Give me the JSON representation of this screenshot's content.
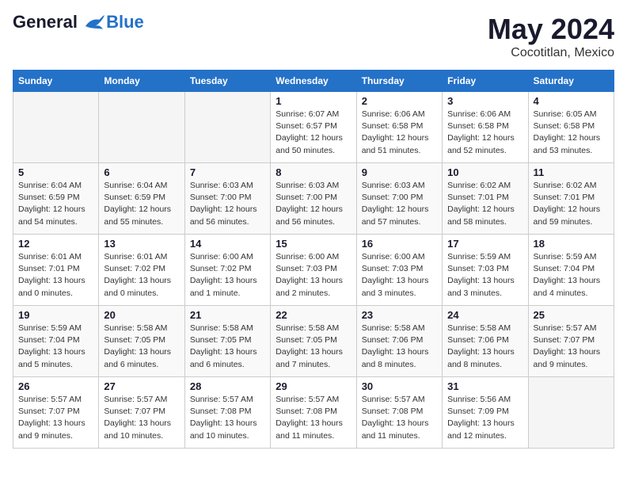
{
  "logo": {
    "line1": "General",
    "line2": "Blue"
  },
  "title": "May 2024",
  "subtitle": "Cocotitlan, Mexico",
  "days_of_week": [
    "Sunday",
    "Monday",
    "Tuesday",
    "Wednesday",
    "Thursday",
    "Friday",
    "Saturday"
  ],
  "weeks": [
    [
      {
        "num": "",
        "detail": ""
      },
      {
        "num": "",
        "detail": ""
      },
      {
        "num": "",
        "detail": ""
      },
      {
        "num": "1",
        "detail": "Sunrise: 6:07 AM\nSunset: 6:57 PM\nDaylight: 12 hours\nand 50 minutes."
      },
      {
        "num": "2",
        "detail": "Sunrise: 6:06 AM\nSunset: 6:58 PM\nDaylight: 12 hours\nand 51 minutes."
      },
      {
        "num": "3",
        "detail": "Sunrise: 6:06 AM\nSunset: 6:58 PM\nDaylight: 12 hours\nand 52 minutes."
      },
      {
        "num": "4",
        "detail": "Sunrise: 6:05 AM\nSunset: 6:58 PM\nDaylight: 12 hours\nand 53 minutes."
      }
    ],
    [
      {
        "num": "5",
        "detail": "Sunrise: 6:04 AM\nSunset: 6:59 PM\nDaylight: 12 hours\nand 54 minutes."
      },
      {
        "num": "6",
        "detail": "Sunrise: 6:04 AM\nSunset: 6:59 PM\nDaylight: 12 hours\nand 55 minutes."
      },
      {
        "num": "7",
        "detail": "Sunrise: 6:03 AM\nSunset: 7:00 PM\nDaylight: 12 hours\nand 56 minutes."
      },
      {
        "num": "8",
        "detail": "Sunrise: 6:03 AM\nSunset: 7:00 PM\nDaylight: 12 hours\nand 56 minutes."
      },
      {
        "num": "9",
        "detail": "Sunrise: 6:03 AM\nSunset: 7:00 PM\nDaylight: 12 hours\nand 57 minutes."
      },
      {
        "num": "10",
        "detail": "Sunrise: 6:02 AM\nSunset: 7:01 PM\nDaylight: 12 hours\nand 58 minutes."
      },
      {
        "num": "11",
        "detail": "Sunrise: 6:02 AM\nSunset: 7:01 PM\nDaylight: 12 hours\nand 59 minutes."
      }
    ],
    [
      {
        "num": "12",
        "detail": "Sunrise: 6:01 AM\nSunset: 7:01 PM\nDaylight: 13 hours\nand 0 minutes."
      },
      {
        "num": "13",
        "detail": "Sunrise: 6:01 AM\nSunset: 7:02 PM\nDaylight: 13 hours\nand 0 minutes."
      },
      {
        "num": "14",
        "detail": "Sunrise: 6:00 AM\nSunset: 7:02 PM\nDaylight: 13 hours\nand 1 minute."
      },
      {
        "num": "15",
        "detail": "Sunrise: 6:00 AM\nSunset: 7:03 PM\nDaylight: 13 hours\nand 2 minutes."
      },
      {
        "num": "16",
        "detail": "Sunrise: 6:00 AM\nSunset: 7:03 PM\nDaylight: 13 hours\nand 3 minutes."
      },
      {
        "num": "17",
        "detail": "Sunrise: 5:59 AM\nSunset: 7:03 PM\nDaylight: 13 hours\nand 3 minutes."
      },
      {
        "num": "18",
        "detail": "Sunrise: 5:59 AM\nSunset: 7:04 PM\nDaylight: 13 hours\nand 4 minutes."
      }
    ],
    [
      {
        "num": "19",
        "detail": "Sunrise: 5:59 AM\nSunset: 7:04 PM\nDaylight: 13 hours\nand 5 minutes."
      },
      {
        "num": "20",
        "detail": "Sunrise: 5:58 AM\nSunset: 7:05 PM\nDaylight: 13 hours\nand 6 minutes."
      },
      {
        "num": "21",
        "detail": "Sunrise: 5:58 AM\nSunset: 7:05 PM\nDaylight: 13 hours\nand 6 minutes."
      },
      {
        "num": "22",
        "detail": "Sunrise: 5:58 AM\nSunset: 7:05 PM\nDaylight: 13 hours\nand 7 minutes."
      },
      {
        "num": "23",
        "detail": "Sunrise: 5:58 AM\nSunset: 7:06 PM\nDaylight: 13 hours\nand 8 minutes."
      },
      {
        "num": "24",
        "detail": "Sunrise: 5:58 AM\nSunset: 7:06 PM\nDaylight: 13 hours\nand 8 minutes."
      },
      {
        "num": "25",
        "detail": "Sunrise: 5:57 AM\nSunset: 7:07 PM\nDaylight: 13 hours\nand 9 minutes."
      }
    ],
    [
      {
        "num": "26",
        "detail": "Sunrise: 5:57 AM\nSunset: 7:07 PM\nDaylight: 13 hours\nand 9 minutes."
      },
      {
        "num": "27",
        "detail": "Sunrise: 5:57 AM\nSunset: 7:07 PM\nDaylight: 13 hours\nand 10 minutes."
      },
      {
        "num": "28",
        "detail": "Sunrise: 5:57 AM\nSunset: 7:08 PM\nDaylight: 13 hours\nand 10 minutes."
      },
      {
        "num": "29",
        "detail": "Sunrise: 5:57 AM\nSunset: 7:08 PM\nDaylight: 13 hours\nand 11 minutes."
      },
      {
        "num": "30",
        "detail": "Sunrise: 5:57 AM\nSunset: 7:08 PM\nDaylight: 13 hours\nand 11 minutes."
      },
      {
        "num": "31",
        "detail": "Sunrise: 5:56 AM\nSunset: 7:09 PM\nDaylight: 13 hours\nand 12 minutes."
      },
      {
        "num": "",
        "detail": ""
      }
    ]
  ]
}
